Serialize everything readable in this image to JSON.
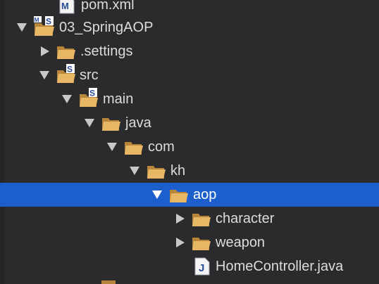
{
  "colors": {
    "background": "#2b2b2d",
    "selection": "#1c5fcc",
    "folder": "#e8b765",
    "folder_dark": "#b8863a",
    "arrow": "#c8c8c8"
  },
  "tree": {
    "items": [
      {
        "label": "pom.xml",
        "icon": "maven-file-icon",
        "arrow": "none"
      },
      {
        "label": "03_SpringAOP",
        "icon": "maven-spring-project-icon",
        "arrow": "expanded"
      },
      {
        "label": ".settings",
        "icon": "folder-icon",
        "arrow": "collapsed"
      },
      {
        "label": "src",
        "icon": "spring-source-folder-icon",
        "arrow": "expanded"
      },
      {
        "label": "main",
        "icon": "spring-source-folder-icon",
        "arrow": "expanded"
      },
      {
        "label": "java",
        "icon": "folder-icon",
        "arrow": "expanded"
      },
      {
        "label": "com",
        "icon": "folder-icon",
        "arrow": "expanded"
      },
      {
        "label": "kh",
        "icon": "folder-icon",
        "arrow": "expanded"
      },
      {
        "label": "aop",
        "icon": "folder-icon",
        "arrow": "expanded",
        "selected": true
      },
      {
        "label": "character",
        "icon": "folder-icon",
        "arrow": "collapsed"
      },
      {
        "label": "weapon",
        "icon": "folder-icon",
        "arrow": "collapsed"
      },
      {
        "label": "HomeController.java",
        "icon": "java-file-icon",
        "arrow": "none"
      }
    ]
  }
}
